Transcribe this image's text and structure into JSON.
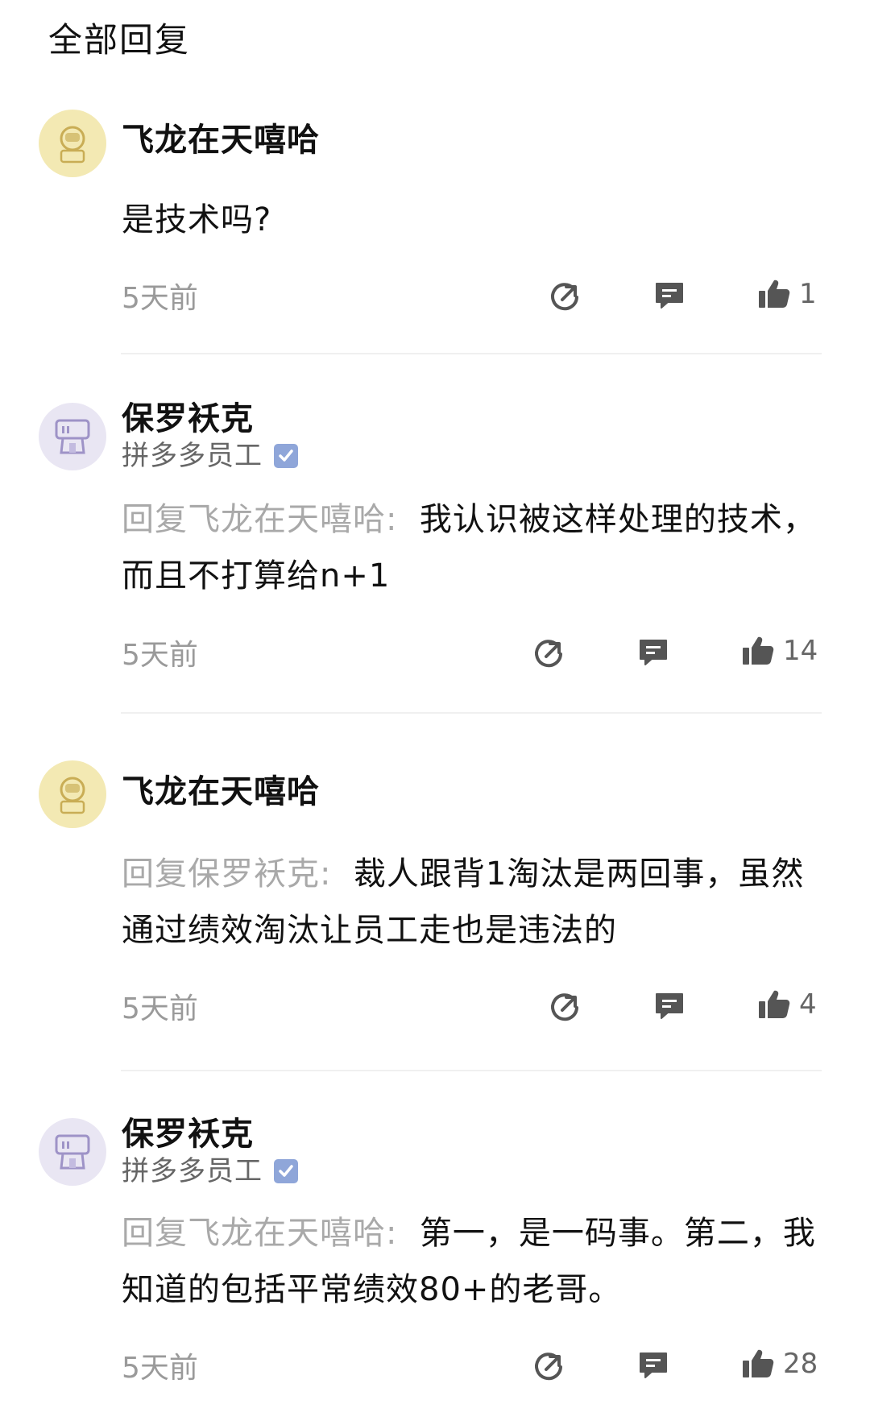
{
  "header": {
    "title": "全部回复"
  },
  "comments": [
    {
      "username": "飞龙在天嘻哈",
      "reply_prefix": "",
      "content": "是技术吗?",
      "time": "5天前",
      "likes": "1"
    },
    {
      "username": "保罗袄克",
      "role": "拼多多员工",
      "reply_prefix": "回复飞龙在天嘻哈:",
      "content": "我认识被这样处理的技术，而且不打算给n+1",
      "time": "5天前",
      "likes": "14"
    },
    {
      "username": "飞龙在天嘻哈",
      "reply_prefix": "回复保罗袄克:",
      "content": "裁人跟背1淘汰是两回事，虽然通过绩效淘汰让员工走也是违法的",
      "time": "5天前",
      "likes": "4"
    },
    {
      "username": "保罗袄克",
      "role": "拼多多员工",
      "reply_prefix": "回复飞龙在天嘻哈:",
      "content": "第一，是一码事。第二，我知道的包括平常绩效80+的老哥。",
      "time": "5天前",
      "likes": "28"
    }
  ],
  "colors": {
    "avatar_yellow": "#f3e9b3",
    "avatar_purple": "#e9e6f3",
    "muted_text": "#a9a9a9",
    "icon_gray": "#555555",
    "verified_badge": "#8fa6d9"
  },
  "icons": {
    "share": "share-arrow-circle-icon",
    "reply": "speech-bubble-icon",
    "like": "thumbs-up-icon",
    "verified": "verified-check-icon"
  }
}
